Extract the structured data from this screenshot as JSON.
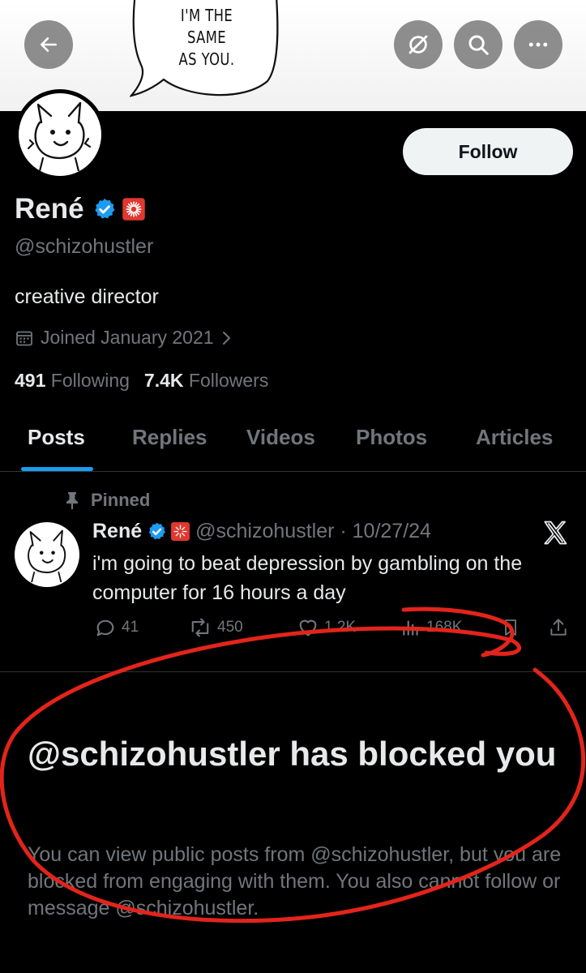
{
  "banner": {
    "speech_lines": [
      "I'M THE",
      "SAME",
      "AS YOU."
    ]
  },
  "topbar": {
    "back_icon": "arrow-left-icon",
    "mute_icon": "slashed-circle-icon",
    "search_icon": "search-icon",
    "more_icon": "more-horizontal-icon"
  },
  "profile": {
    "name": "René",
    "handle": "@schizohustler",
    "bio": "creative director",
    "joined": "Joined January 2021",
    "following_count": "491",
    "following_label": "Following",
    "followers_count": "7.4K",
    "followers_label": "Followers",
    "follow_label": "Follow",
    "verified_color": "#1d9bf0",
    "affiliate_badge_color": "#e0382f"
  },
  "tabs": [
    {
      "label": "Posts",
      "active": true
    },
    {
      "label": "Replies",
      "active": false
    },
    {
      "label": "Videos",
      "active": false
    },
    {
      "label": "Photos",
      "active": false
    },
    {
      "label": "Articles",
      "active": false
    }
  ],
  "pinned_post": {
    "pinned_label": "Pinned",
    "author": "René",
    "handle_date": "@schizohustler · 10/27/24",
    "text": "i'm going to beat depression by gambling on the computer for 16 hours a day",
    "replies": "41",
    "reposts": "450",
    "likes": "1.2K",
    "views": "168K"
  },
  "blocked": {
    "title": "@schizohustler has blocked you",
    "description": "You can view public posts from @schizohustler, but you are blocked from engaging with them. You also cannot follow or message @schizohustler."
  },
  "colors": {
    "accent": "#1d9bf0",
    "muted_text": "#71767b",
    "annotation_red": "#e3241b"
  }
}
